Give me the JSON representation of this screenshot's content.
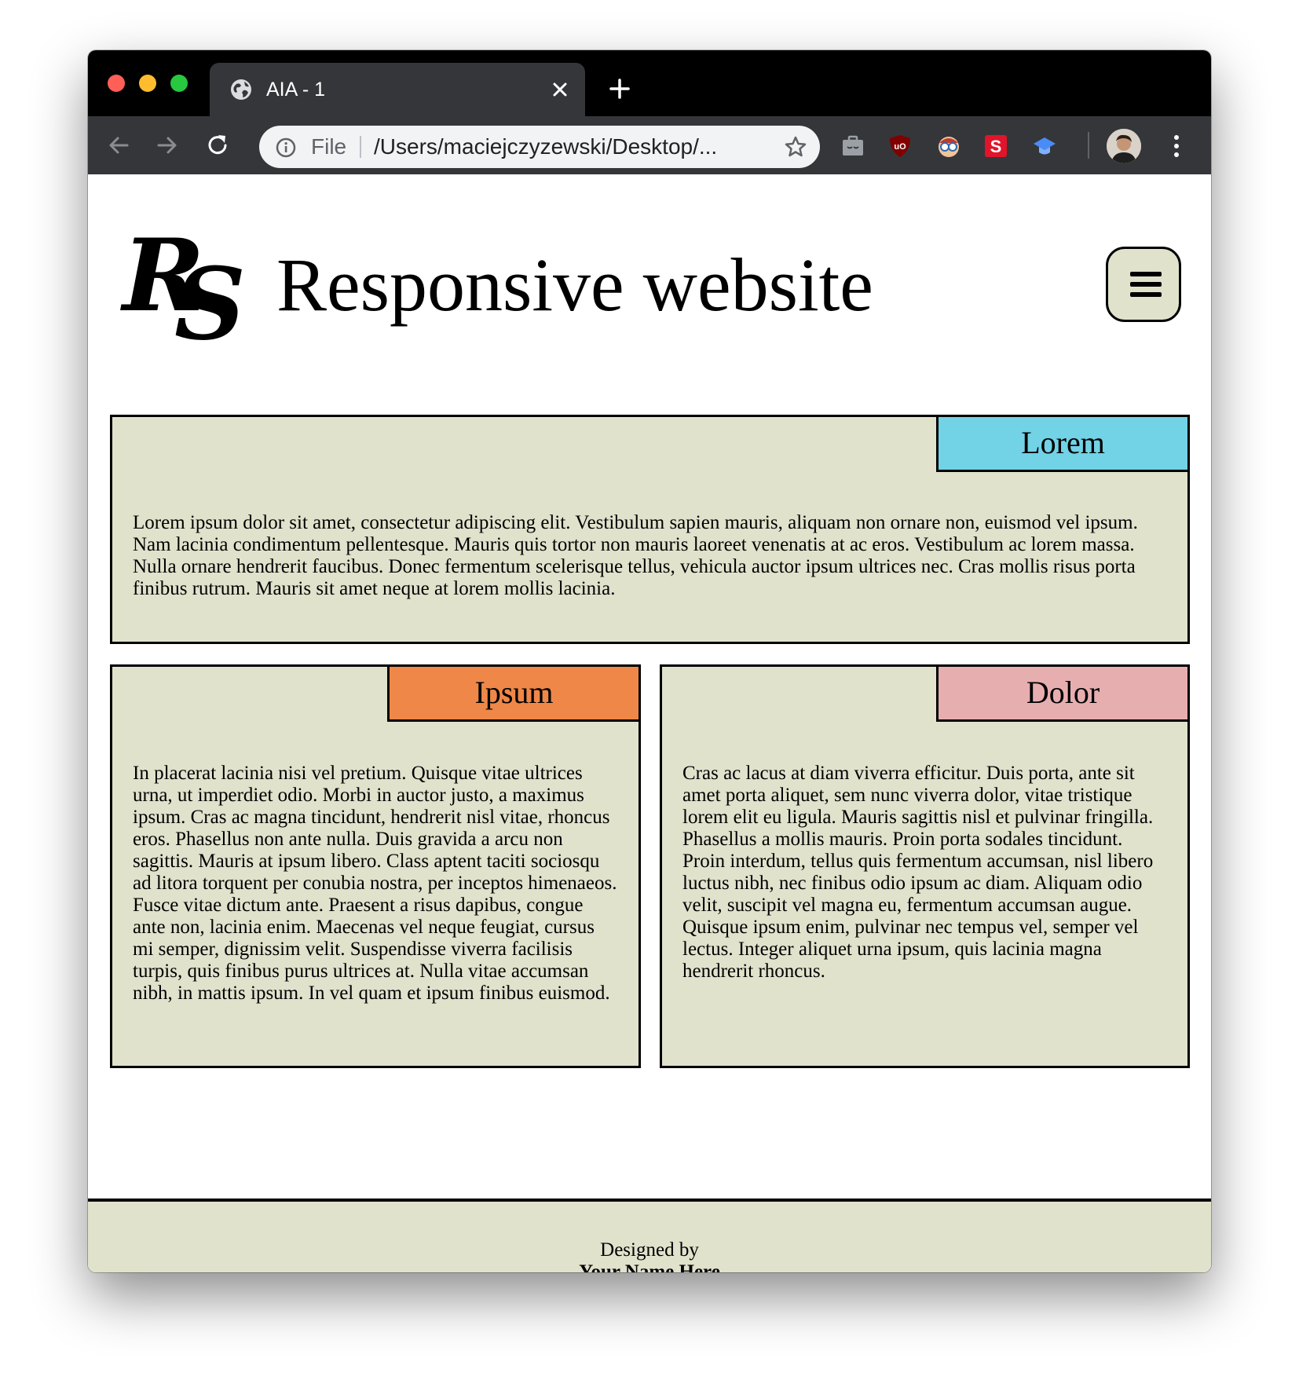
{
  "browser": {
    "tab_title": "AIA - 1",
    "address_scheme": "File",
    "address_url": "/Users/maciejczyzewski/Desktop/..."
  },
  "header": {
    "logo_letters": [
      "R",
      "S"
    ],
    "title": "Responsive website"
  },
  "cards": [
    {
      "label": "Lorem",
      "label_color": "#72d2e6",
      "text": "Lorem ipsum dolor sit amet, consectetur adipiscing elit. Vestibulum sapien mauris, aliquam non ornare non, euismod vel ipsum. Nam lacinia condimentum pellentesque. Mauris quis tortor non mauris laoreet venenatis at ac eros. Vestibulum ac lorem massa. Nulla ornare hendrerit faucibus. Donec fermentum scelerisque tellus, vehicula auctor ipsum ultrices nec. Cras mollis risus porta finibus rutrum. Mauris sit amet neque at lorem mollis lacinia."
    },
    {
      "label": "Ipsum",
      "label_color": "#ef8748",
      "text": "In placerat lacinia nisi vel pretium. Quisque vitae ultrices urna, ut imperdiet odio. Morbi in auctor justo, a maximus ipsum. Cras ac magna tincidunt, hendrerit nisl vitae, rhoncus eros. Phasellus non ante nulla. Duis gravida a arcu non sagittis. Mauris at ipsum libero. Class aptent taciti sociosqu ad litora torquent per conubia nostra, per inceptos himenaeos. Fusce vitae dictum ante. Praesent a risus dapibus, congue ante non, lacinia enim. Maecenas vel neque feugiat, cursus mi semper, dignissim velit. Suspendisse viverra facilisis turpis, quis finibus purus ultrices at. Nulla vitae accumsan nibh, in mattis ipsum. In vel quam et ipsum finibus euismod."
    },
    {
      "label": "Dolor",
      "label_color": "#e7aeb0",
      "text": "Cras ac lacus at diam viverra efficitur. Duis porta, ante sit amet porta aliquet, sem nunc viverra dolor, vitae tristique lorem elit eu ligula. Mauris sagittis nisl et pulvinar fringilla. Phasellus a mollis mauris. Proin porta sodales tincidunt. Proin interdum, tellus quis fermentum accumsan, nisl libero luctus nibh, nec finibus odio ipsum ac diam. Aliquam odio velit, suscipit vel magna eu, fermentum accumsan augue. Quisque ipsum enim, pulvinar nec tempus vel, semper vel lectus. Integer aliquet urna ipsum, quis lacinia magna hendrerit rhoncus."
    }
  ],
  "footer": {
    "line1": "Designed by",
    "line2": "Your Name Here"
  },
  "colors": {
    "card_background": "#e0e2cc",
    "tab_bar": "#000000",
    "toolbar": "#35363a"
  },
  "icons": [
    "globe-icon",
    "close-icon",
    "new-tab-icon",
    "back-icon",
    "forward-icon",
    "reload-icon",
    "info-icon",
    "star-icon",
    "extension-briefcase-icon",
    "ublock-icon",
    "extension-glasses-icon",
    "extension-s-icon",
    "extension-cap-icon",
    "profile-avatar",
    "menu-dots-icon",
    "hamburger-menu-icon"
  ]
}
